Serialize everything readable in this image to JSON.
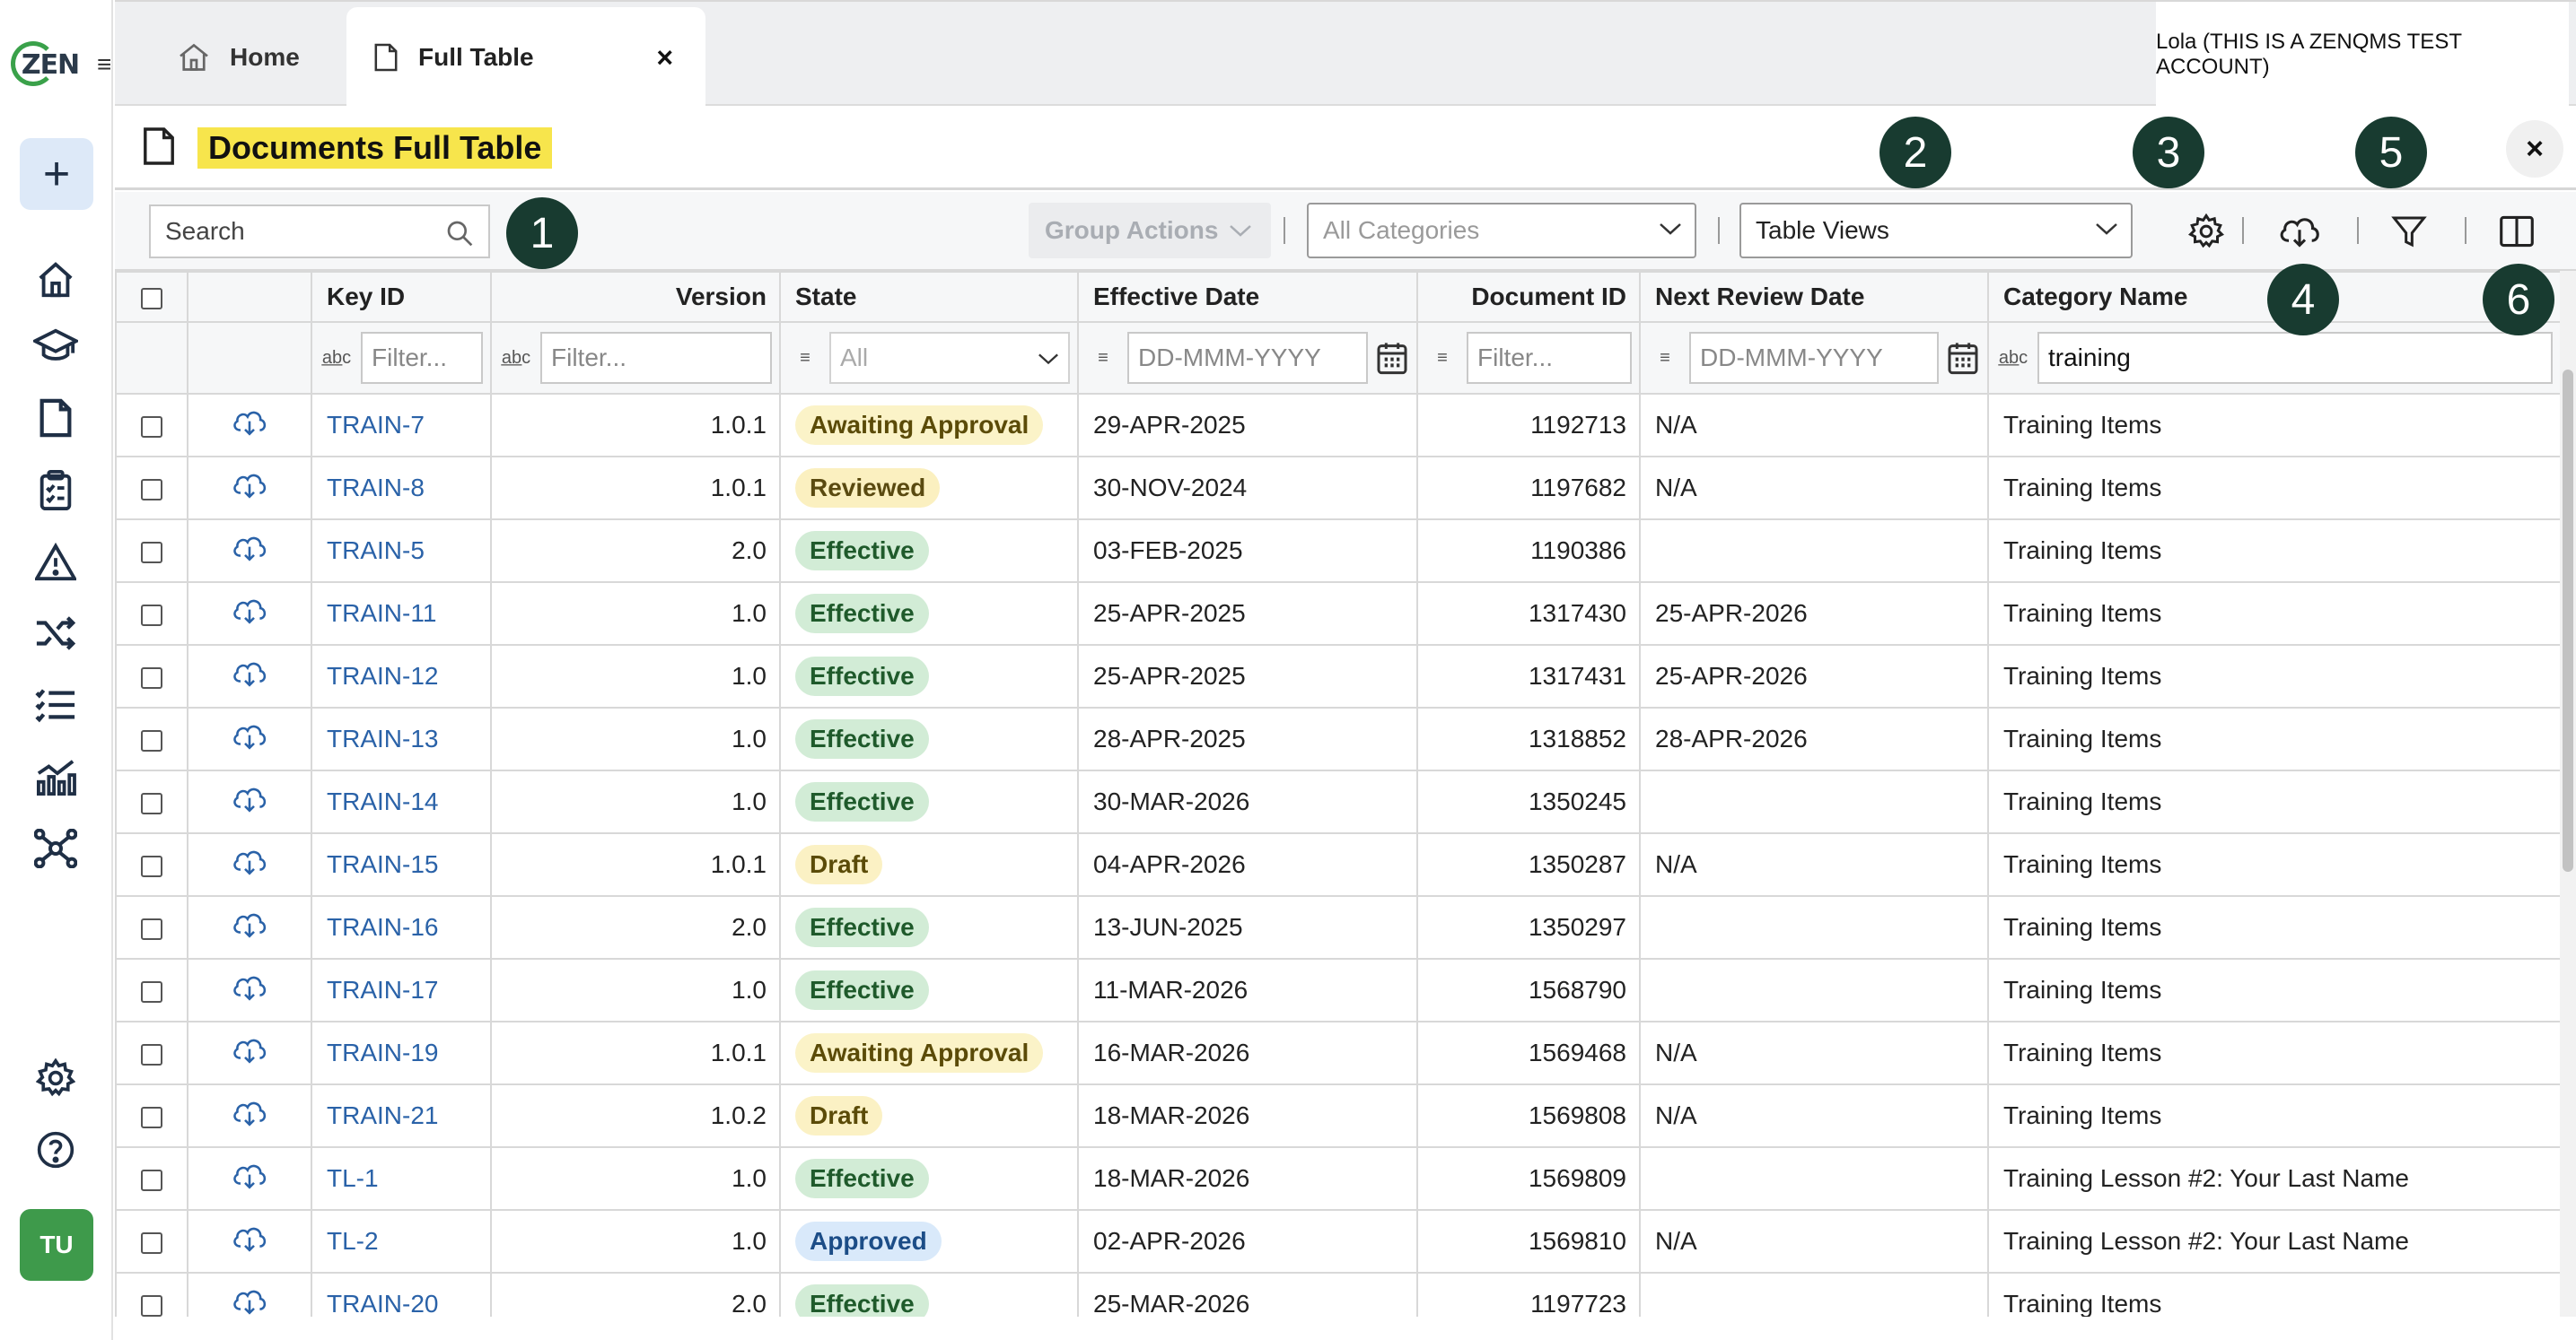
{
  "app": {
    "logo_text": "ZEN",
    "account": "Lola (THIS IS A ZENQMS TEST ACCOUNT)",
    "avatar_initials": "TU"
  },
  "tabs": [
    {
      "label": "Home"
    },
    {
      "label": "Full Table"
    }
  ],
  "page": {
    "title": "Documents Full Table"
  },
  "toolbar": {
    "search_placeholder": "Search",
    "group_actions": "Group Actions",
    "categories_selected": "All Categories",
    "views_selected": "Table Views"
  },
  "badges": [
    "1",
    "2",
    "3",
    "4",
    "5",
    "6"
  ],
  "table": {
    "columns": [
      "Key ID",
      "Version",
      "State",
      "Effective Date",
      "Document ID",
      "Next Review Date",
      "Category Name"
    ],
    "filters": {
      "key_id": "Filter...",
      "version": "Filter...",
      "state": "All",
      "effective_date": "DD-MMM-YYYY",
      "document_id": "Filter...",
      "next_review_date": "DD-MMM-YYYY",
      "category_name": "training"
    },
    "rows": [
      {
        "key": "TRAIN-7",
        "version": "1.0.1",
        "state": "Awaiting Approval",
        "state_class": "awaiting",
        "effective": "29-APR-2025",
        "doc_id": "1192713",
        "next_review": "N/A",
        "category": "Training Items"
      },
      {
        "key": "TRAIN-8",
        "version": "1.0.1",
        "state": "Reviewed",
        "state_class": "reviewed",
        "effective": "30-NOV-2024",
        "doc_id": "1197682",
        "next_review": "N/A",
        "category": "Training Items"
      },
      {
        "key": "TRAIN-5",
        "version": "2.0",
        "state": "Effective",
        "state_class": "effective",
        "effective": "03-FEB-2025",
        "doc_id": "1190386",
        "next_review": "",
        "category": "Training Items"
      },
      {
        "key": "TRAIN-11",
        "version": "1.0",
        "state": "Effective",
        "state_class": "effective",
        "effective": "25-APR-2025",
        "doc_id": "1317430",
        "next_review": "25-APR-2026",
        "category": "Training Items"
      },
      {
        "key": "TRAIN-12",
        "version": "1.0",
        "state": "Effective",
        "state_class": "effective",
        "effective": "25-APR-2025",
        "doc_id": "1317431",
        "next_review": "25-APR-2026",
        "category": "Training Items"
      },
      {
        "key": "TRAIN-13",
        "version": "1.0",
        "state": "Effective",
        "state_class": "effective",
        "effective": "28-APR-2025",
        "doc_id": "1318852",
        "next_review": "28-APR-2026",
        "category": "Training Items"
      },
      {
        "key": "TRAIN-14",
        "version": "1.0",
        "state": "Effective",
        "state_class": "effective",
        "effective": "30-MAR-2026",
        "doc_id": "1350245",
        "next_review": "",
        "category": "Training Items"
      },
      {
        "key": "TRAIN-15",
        "version": "1.0.1",
        "state": "Draft",
        "state_class": "draft",
        "effective": "04-APR-2026",
        "doc_id": "1350287",
        "next_review": "N/A",
        "category": "Training Items"
      },
      {
        "key": "TRAIN-16",
        "version": "2.0",
        "state": "Effective",
        "state_class": "effective",
        "effective": "13-JUN-2025",
        "doc_id": "1350297",
        "next_review": "",
        "category": "Training Items"
      },
      {
        "key": "TRAIN-17",
        "version": "1.0",
        "state": "Effective",
        "state_class": "effective",
        "effective": "11-MAR-2026",
        "doc_id": "1568790",
        "next_review": "",
        "category": "Training Items"
      },
      {
        "key": "TRAIN-19",
        "version": "1.0.1",
        "state": "Awaiting Approval",
        "state_class": "awaiting",
        "effective": "16-MAR-2026",
        "doc_id": "1569468",
        "next_review": "N/A",
        "category": "Training Items"
      },
      {
        "key": "TRAIN-21",
        "version": "1.0.2",
        "state": "Draft",
        "state_class": "draft",
        "effective": "18-MAR-2026",
        "doc_id": "1569808",
        "next_review": "N/A",
        "category": "Training Items"
      },
      {
        "key": "TL-1",
        "version": "1.0",
        "state": "Effective",
        "state_class": "effective",
        "effective": "18-MAR-2026",
        "doc_id": "1569809",
        "next_review": "",
        "category": "Training Lesson #2: Your Last Name"
      },
      {
        "key": "TL-2",
        "version": "1.0",
        "state": "Approved",
        "state_class": "approved",
        "effective": "02-APR-2026",
        "doc_id": "1569810",
        "next_review": "N/A",
        "category": "Training Lesson #2: Your Last Name"
      },
      {
        "key": "TRAIN-20",
        "version": "2.0",
        "state": "Effective",
        "state_class": "effective",
        "effective": "25-MAR-2026",
        "doc_id": "1197723",
        "next_review": "",
        "category": "Training Items"
      }
    ]
  },
  "colors": {
    "highlight": "#f7e54c",
    "badge": "#183b30",
    "link": "#2a62a8",
    "avatar": "#3e9a4b"
  }
}
